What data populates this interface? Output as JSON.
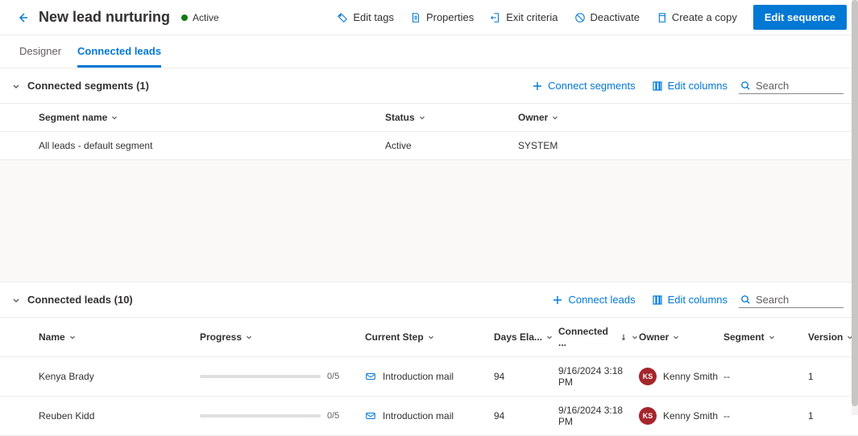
{
  "header": {
    "title": "New lead nurturing",
    "status_label": "Active",
    "toolbar": {
      "edit_tags": "Edit tags",
      "properties": "Properties",
      "exit_criteria": "Exit criteria",
      "deactivate": "Deactivate",
      "create_copy": "Create a copy",
      "edit_sequence": "Edit sequence"
    }
  },
  "tabs": {
    "designer": "Designer",
    "connected_leads": "Connected leads"
  },
  "segments_section": {
    "title": "Connected segments (1)",
    "connect_label": "Connect segments",
    "edit_columns_label": "Edit columns",
    "search_placeholder": "Search",
    "columns": {
      "segment_name": "Segment name",
      "status": "Status",
      "owner": "Owner"
    },
    "rows": [
      {
        "name": "All leads - default segment",
        "status": "Active",
        "owner": "SYSTEM"
      }
    ]
  },
  "leads_section": {
    "title": "Connected leads (10)",
    "connect_label": "Connect leads",
    "edit_columns_label": "Edit columns",
    "search_placeholder": "Search",
    "columns": {
      "name": "Name",
      "progress": "Progress",
      "current_step": "Current Step",
      "days_elapsed": "Days Ela...",
      "connected": "Connected ...",
      "owner": "Owner",
      "segment": "Segment",
      "version": "Version"
    },
    "rows": [
      {
        "name": "Kenya Brady",
        "progress_text": "0/5",
        "step": "Introduction mail",
        "days": "94",
        "connected": "9/16/2024 3:18 PM",
        "owner_initials": "KS",
        "owner_name": "Kenny Smith",
        "segment": "--",
        "version": "1"
      },
      {
        "name": "Reuben Kidd",
        "progress_text": "0/5",
        "step": "Introduction mail",
        "days": "94",
        "connected": "9/16/2024 3:18 PM",
        "owner_initials": "KS",
        "owner_name": "Kenny Smith",
        "segment": "--",
        "version": "1"
      }
    ]
  }
}
